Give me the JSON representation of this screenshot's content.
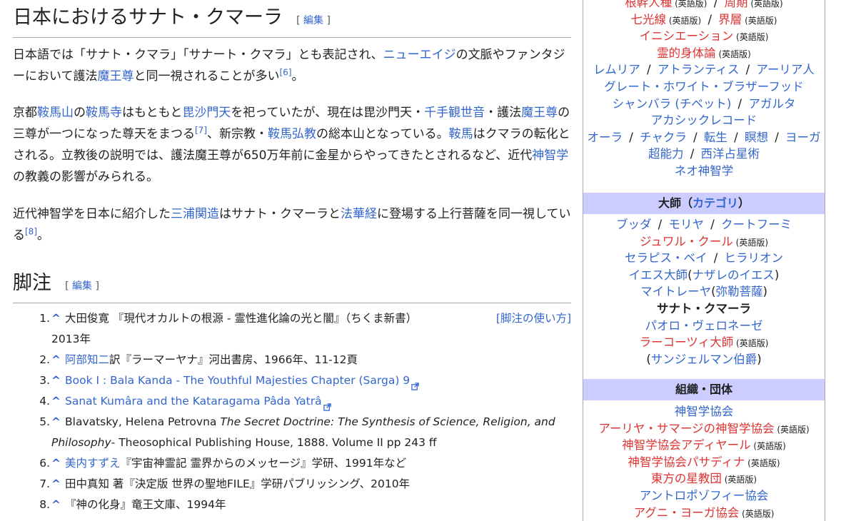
{
  "section1": {
    "title": "日本におけるサナト・クマーラ",
    "edit_open": "[",
    "edit_label": "編集",
    "edit_close": "]"
  },
  "paragraphs": {
    "p1": {
      "t1": "日本語では「サナト・クマラ」「サナート・クマラ」とも表記され、",
      "l1": "ニューエイジ",
      "t2": "の文脈やファンタジーにおいて護法",
      "l2": "魔王尊",
      "t3": "と同一視されることが多い",
      "ref": "[6]",
      "t4": "。"
    },
    "p2": {
      "t1": "京都",
      "l1": "鞍馬山",
      "t2": "の",
      "l2": "鞍馬寺",
      "t3": "はもともと",
      "l3": "毘沙門天",
      "t4": "を祀っていたが、現在は毘沙門天・",
      "l4": "千手観世音",
      "t5": "・護法",
      "l5": "魔王尊",
      "t6": "の三尊が一つになった尊天をまつる",
      "ref": "[7]",
      "t7": "、新宗教・",
      "l6": "鞍馬弘教",
      "t8": "の総本山となっている。",
      "l7": "鞍馬",
      "t9": "はクマラの転化とされる。立教後の説明では、護法魔王尊が650万年前に金星からやってきたとされるなど、近代",
      "l8": "神智学",
      "t10": "の教義の影響がみられる。"
    },
    "p3": {
      "t1": "近代神智学を日本に紹介した",
      "l1": "三浦関造",
      "t2": "はサナト・クマーラと",
      "l2": "法華経",
      "t3": "に登場する上行菩薩を同一視している",
      "ref": "[8]",
      "t4": "。"
    }
  },
  "section2": {
    "title": "脚注",
    "edit_open": "[",
    "edit_label": "編集",
    "edit_close": "]",
    "howto_label": "[脚注の使い方]"
  },
  "footnotes": [
    {
      "num": "1.",
      "caret": "^",
      "text": "大田俊寛 『現代オカルトの根源 - 霊性進化論の光と闇』（ちくま新書）",
      "text2": "2013年"
    },
    {
      "num": "2.",
      "caret": "^",
      "link": "阿部知二",
      "text": "訳『ラーマーヤナ』河出書房、1966年、11-12頁"
    },
    {
      "num": "3.",
      "caret": "^",
      "link": "Book I : Bala Kanda - The Youthful Majesties Chapter (Sarga) 9"
    },
    {
      "num": "4.",
      "caret": "^",
      "link": "Sanat Kumâra and the Kataragama Pâda Yatrâ"
    },
    {
      "num": "5.",
      "caret": "^",
      "text": "Blavatsky, Helena Petrovna ",
      "italic": "The Secret Doctrine: The Synthesis of Science, Religion, and Philosophy",
      "text2": "- Theosophical Publishing House, 1888. Volume II pp 243 ff"
    },
    {
      "num": "6.",
      "caret": "^",
      "link": "美内すずえ",
      "text": "『宇宙神霊記 霊界からのメッセージ』学研、1991年など"
    },
    {
      "num": "7.",
      "caret": "^",
      "text": "田中真知 著『決定版 世界の聖地FILE』学研パブリッシング、2010年"
    },
    {
      "num": "8.",
      "caret": "^",
      "text": "『神の化身』竜王文庫、1994年"
    }
  ],
  "sidebar": {
    "top_lines": [
      {
        "items": [
          {
            "label": "根幹人種",
            "color": "red",
            "en": "(英語版)"
          },
          {
            "label": "周期",
            "color": "red",
            "en": "(英語版)"
          }
        ]
      },
      {
        "items": [
          {
            "label": "七光線",
            "color": "red",
            "en": "(英語版)"
          },
          {
            "label": "界層",
            "color": "red",
            "en": "(英語版)"
          }
        ]
      },
      {
        "items": [
          {
            "label": "イニシエーション",
            "color": "red",
            "en": "(英語版)"
          }
        ]
      },
      {
        "items": [
          {
            "label": "霊的身体論",
            "color": "red",
            "en": "(英語版)"
          }
        ]
      },
      {
        "items": [
          {
            "label": "レムリア",
            "color": "blue"
          },
          {
            "label": "アトランティス",
            "color": "blue"
          },
          {
            "label": "アーリア人",
            "color": "blue"
          }
        ]
      },
      {
        "items": [
          {
            "label": "グレート・ホワイト・ブラザーフッド",
            "color": "blue"
          }
        ]
      },
      {
        "items": [
          {
            "label": "シャンバラ (チベット)",
            "color": "blue"
          },
          {
            "label": "アガルタ",
            "color": "blue"
          }
        ]
      },
      {
        "items": [
          {
            "label": "アカシックレコード",
            "color": "blue"
          }
        ]
      },
      {
        "items": [
          {
            "label": "オーラ",
            "color": "blue"
          },
          {
            "label": "チャクラ",
            "color": "blue"
          },
          {
            "label": "転生",
            "color": "blue"
          },
          {
            "label": "瞑想",
            "color": "blue"
          },
          {
            "label": "ヨーガ",
            "color": "blue"
          }
        ]
      },
      {
        "items": [
          {
            "label": "超能力",
            "color": "blue"
          },
          {
            "label": "西洋占星術",
            "color": "blue"
          }
        ]
      },
      {
        "items": [
          {
            "label": "ネオ神智学",
            "color": "blue"
          }
        ]
      }
    ],
    "masters_header": {
      "label": "大師",
      "open": "（",
      "link": "カテゴリ",
      "close": "）"
    },
    "masters_lines": [
      {
        "items": [
          {
            "label": "ブッダ",
            "color": "blue"
          },
          {
            "label": "モリヤ",
            "color": "blue"
          },
          {
            "label": "クートフーミ",
            "color": "blue"
          }
        ]
      },
      {
        "items": [
          {
            "label": "ジュワル・クール",
            "color": "red",
            "en": "(英語版)"
          }
        ]
      },
      {
        "items": [
          {
            "label": "セラピス・ベイ",
            "color": "blue"
          },
          {
            "label": "ヒラリオン",
            "color": "blue"
          }
        ]
      },
      {
        "items": [
          {
            "label": "イエス大師",
            "color": "blue",
            "paren": "ナザレのイエス"
          }
        ]
      },
      {
        "items": [
          {
            "label": "マイトレーヤ",
            "color": "blue",
            "paren": "弥勒菩薩"
          }
        ]
      },
      {
        "items": [
          {
            "label": "サナト・クマーラ",
            "color": "self"
          }
        ]
      },
      {
        "items": [
          {
            "label": "パオロ・ヴェロネーゼ",
            "color": "blue"
          }
        ]
      },
      {
        "items": [
          {
            "label": "ラーコーツィ大師",
            "color": "red",
            "en": "(英語版)"
          }
        ]
      },
      {
        "items": [
          {
            "label": "サンジェルマン伯爵",
            "color": "blue",
            "wrapparen": true
          }
        ]
      }
    ],
    "org_header": {
      "label": "組織・団体"
    },
    "org_lines": [
      {
        "items": [
          {
            "label": "神智学協会",
            "color": "blue"
          }
        ]
      },
      {
        "items": [
          {
            "label": "アーリヤ・サマージの神智学協会",
            "color": "red",
            "en": "(英語版)"
          }
        ]
      },
      {
        "items": [
          {
            "label": "神智学協会アディヤール",
            "color": "red",
            "en": "(英語版)"
          }
        ]
      },
      {
        "items": [
          {
            "label": "神智学協会パサディナ",
            "color": "red",
            "en": "(英語版)"
          }
        ]
      },
      {
        "items": [
          {
            "label": "東方の星教団",
            "color": "red",
            "en": "(英語版)"
          }
        ]
      },
      {
        "items": [
          {
            "label": "アントロポゾフィー協会",
            "color": "blue"
          }
        ]
      },
      {
        "items": [
          {
            "label": "アグニ・ヨーガ協会",
            "color": "red",
            "en": "(英語版)"
          }
        ]
      }
    ],
    "separator": "/",
    "colors": {
      "link": "#3366cc",
      "redlink": "#d33333",
      "header_bg": "#ccccff",
      "border": "#a2a9b1"
    }
  }
}
